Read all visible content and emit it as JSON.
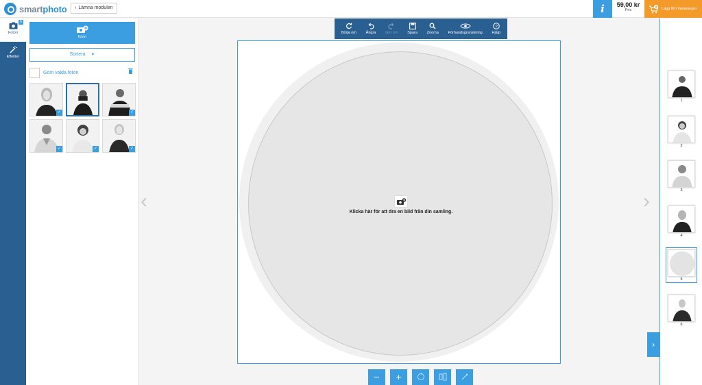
{
  "app": {
    "logo_prefix": "smart",
    "logo_suffix": "photo",
    "leave_label": "Lämna modulen"
  },
  "header": {
    "info_icon": "i",
    "price_value": "59,00 kr",
    "price_label": "Pris",
    "cart_label": "Lägg till i Varukorgen"
  },
  "nav": {
    "items": [
      {
        "label": "Foton",
        "icon": "camera-icon",
        "badge": "6"
      },
      {
        "label": "Effekter",
        "icon": "magic-wand-icon"
      }
    ]
  },
  "photos_panel": {
    "add_label": "foton",
    "sort_label": "Sortera",
    "hide_label": "Göm valda foton"
  },
  "toolbar": {
    "items": [
      {
        "label": "Börja om",
        "icon": "refresh-icon",
        "enabled": true
      },
      {
        "label": "Ångra",
        "icon": "undo-icon",
        "enabled": true
      },
      {
        "label": "Gör om",
        "icon": "redo-icon",
        "enabled": false
      },
      {
        "label": "Spara",
        "icon": "save-icon",
        "enabled": true
      },
      {
        "label": "Zooma",
        "icon": "zoom-icon",
        "enabled": true
      },
      {
        "label": "Förhandsgranskning",
        "icon": "eye-icon",
        "enabled": true
      },
      {
        "label": "Hjälp",
        "icon": "help-icon",
        "enabled": true
      }
    ]
  },
  "canvas": {
    "drop_text": "Klicka här för att dra en bild från din samling."
  },
  "bottom_tools": {
    "zoom_out": "−",
    "zoom_in": "+"
  },
  "pages": {
    "items": [
      {
        "number": "1"
      },
      {
        "number": "2"
      },
      {
        "number": "3"
      },
      {
        "number": "4"
      },
      {
        "number": "5"
      },
      {
        "number": "6"
      }
    ],
    "active_page": "5"
  },
  "colors": {
    "accent": "#3a9ee0",
    "nav": "#2a5f92",
    "cart": "#f39a2b"
  }
}
